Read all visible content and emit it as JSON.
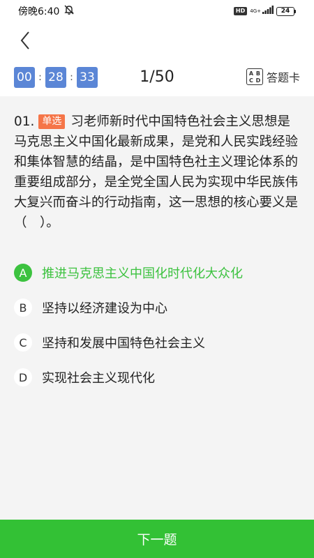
{
  "status_bar": {
    "time": "傍晚6:40",
    "hd": "HD",
    "network": "4G+",
    "battery": "24"
  },
  "timer": {
    "hours": "00",
    "minutes": "28",
    "seconds": "33",
    "separator": ":"
  },
  "progress": "1/50",
  "answer_card": {
    "icon_letters": [
      "A",
      "B",
      "C",
      "D"
    ],
    "label": "答题卡"
  },
  "question": {
    "number": "01.",
    "type": "单选",
    "text": "习老师新时代中国特色社会主义思想是马克思主义中国化最新成果，是党和人民实践经验和集体智慧的结晶，是中国特色社主义理论体系的重要组成部分，是全党全国人民为实现中华民族伟大复兴而奋斗的行动指南，这一思想的核心要义是（　）。"
  },
  "options": [
    {
      "letter": "A",
      "text": "推进马克思主义中国化时代化大众化",
      "selected": true
    },
    {
      "letter": "B",
      "text": "坚持以经济建设为中心",
      "selected": false
    },
    {
      "letter": "C",
      "text": "坚持和发展中国特色社会主义",
      "selected": false
    },
    {
      "letter": "D",
      "text": "实现社会主义现代化",
      "selected": false
    }
  ],
  "next_button": "下一题",
  "colors": {
    "accent_green": "#33c135",
    "timer_blue": "#5b86d6",
    "type_badge": "#f57548"
  }
}
